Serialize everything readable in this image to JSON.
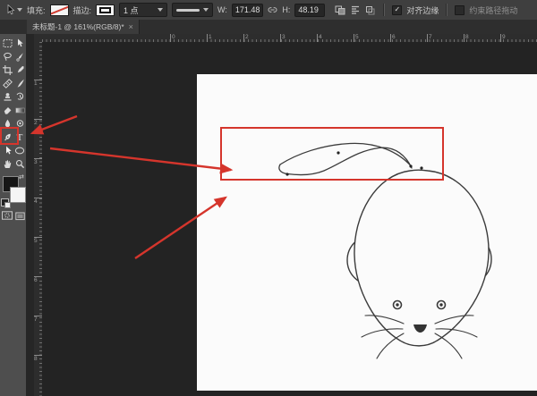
{
  "options_bar": {
    "fill_label": "填充:",
    "stroke_label": "描边:",
    "stroke_width": "1 点",
    "w_label": "W:",
    "w_value": "171.48",
    "h_label": "H:",
    "h_value": "48.19",
    "align_edges": "对齐边缘",
    "align_edges_checked": true,
    "check_glyph": "✓",
    "constrain_path": "约束路径拖动",
    "constrain_path_checked": false
  },
  "tab": {
    "title": "未标题-1 @ 161%(RGB/8)*",
    "close_label": "×"
  },
  "toolbar": {
    "type_tool_glyph": "T",
    "tool_icons": [
      "rectangular-marquee-icon",
      "move-icon",
      "lasso-icon",
      "quick-selection-icon",
      "crop-icon",
      "eyedropper-icon",
      "healing-brush-icon",
      "brush-icon",
      "clone-stamp-icon",
      "history-brush-icon",
      "eraser-icon",
      "gradient-icon",
      "blur-icon",
      "dodge-icon",
      "pen-icon",
      "type-icon",
      "path-selection-icon",
      "ellipse-shape-icon",
      "hand-icon",
      "zoom-icon",
      "quick-mask-icon",
      "screen-mode-icon"
    ],
    "highlighted_tool": "pen-icon"
  },
  "rulers": {
    "top_labels": [
      "0",
      "1",
      "2",
      "3",
      "4",
      "5",
      "6",
      "7",
      "8",
      "9"
    ],
    "left_labels": [
      "1",
      "2",
      "3",
      "4",
      "5",
      "6",
      "7",
      "8"
    ]
  },
  "canvas": {
    "drawing": "line-art mouse with ears, eyes, nose, whiskers and pen-path tail"
  },
  "annotations": {
    "description": "red box around pen tool, red box around tail path, three red arrows",
    "red": "#d5352c"
  },
  "colors": {
    "options_bar_bg": "#3f3f3f",
    "toolbar_bg": "#4e4e4e",
    "pasteboard_bg": "#232323",
    "canvas_bg": "#fbfbfb",
    "annotation_red": "#d5352c"
  }
}
